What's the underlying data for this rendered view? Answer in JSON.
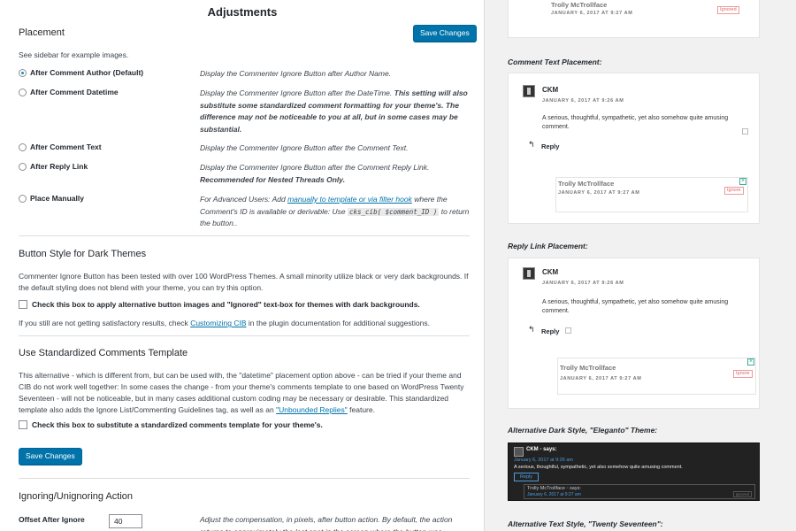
{
  "page": {
    "title": "Adjustments"
  },
  "placement": {
    "title": "Placement",
    "save_label": "Save Changes",
    "hint": "See sidebar for example images.",
    "options": [
      {
        "label": "After Comment Author (Default)",
        "desc": "Display the Commenter Ignore Button after Author Name.",
        "checked": true
      },
      {
        "label": "After Comment Datetime",
        "desc": "Display the Commenter Ignore Button after the DateTime.",
        "desc_bold": "This setting will also substitute some standardized comment formatting for your theme's. The difference may not be noticeable to you at all, but in some cases may be substantial.",
        "checked": false
      },
      {
        "label": "After Comment Text",
        "desc": "Display the Commenter Ignore Button after the Comment Text.",
        "checked": false
      },
      {
        "label": "After Reply Link",
        "desc": "Display the Commenter Ignore Button after the Comment Reply Link.",
        "desc_bold": "Recommended for Nested Threads Only.",
        "checked": false
      },
      {
        "label": "Place Manually",
        "desc_pre": "For Advanced Users: Add",
        "desc_link": "manually to template or via filter hook",
        "desc_mid": "where the Comment's ID is available or derivable: Use",
        "desc_code": "cks_cib( $comment_ID )",
        "desc_post": "to return the button..",
        "checked": false
      }
    ]
  },
  "dark": {
    "title": "Button Style for Dark Themes",
    "para": "Commenter Ignore Button has been tested with over 100 WordPress Themes. A small minority utilize black or very dark backgrounds. If the default styling does not blend with your theme, you can try this option.",
    "check_label": "Check this box to apply alternative button images and \"Ignored\" text-box for themes with dark backgrounds.",
    "note_pre": "If you still are not getting satisfactory results, check",
    "note_link": "Customizing CIB",
    "note_post": "in the plugin documentation for additional suggestions."
  },
  "template": {
    "title": "Use Standardized Comments Template",
    "para": "This alternative - which is different from, but can be used with, the \"datetime\" placement option above - can be tried if your theme and CIB do not work well together: In some cases the change - from your theme's comments template to one based on WordPress Twenty Seventeen - will not be noticeable, but in many cases additional custom coding may be necessary or desirable. This standardized template also adds the Ignore List/Commenting Guidelines tag, as well as an",
    "para_link": "\"Unbounded Replies\"",
    "para_end": "feature.",
    "check_label": "Check this box to substitute a standardized comments template for your theme's.",
    "save_label": "Save Changes"
  },
  "ignoring": {
    "title": "Ignoring/Unignoring Action",
    "offset_label": "Offset After Ignore",
    "offset_value": "40",
    "offset_desc": "Adjust the compensation, in pixels, after button action. By default, the action returns to approximately the last spot in the screen where the button was"
  },
  "sidebar": {
    "top_author": "Trolly McTrollface",
    "top_date": "JANUARY 6, 2017 AT 9:27 AM",
    "top_badge": "Ignored",
    "cap_text": "Comment Text Placement:",
    "cap_reply": "Reply Link Placement:",
    "cap_dark": "Alternative Dark Style, \"Eleganto\" Theme:",
    "cap_text_style": "Alternative Text Style, \"Twenty Seventeen\":",
    "author": "CKM",
    "date": "JANUARY 6, 2017 AT 9:26 AM",
    "comment": "A serious, thoughtful, sympathetic, yet also somehow quite amusing comment.",
    "reply": "Reply",
    "nested_author": "Trolly McTrollface",
    "nested_date": "JANUARY 6, 2017 AT 9:27 AM",
    "badge": "Ignore",
    "dark_says": "says:",
    "dark_author": "CKM",
    "dark_date": "January 6, 2017 at 9:26 am",
    "dark_comment": "A serious, thoughtful, sympathetic, yet also somehow quite amusing comment.",
    "dark_reply": "Reply",
    "dark_nested_author": "Trolly McTrollface",
    "dark_nested_date": "January 6, 2017 at 9:27 am",
    "dark_badge": "Ignored"
  },
  "colors": {
    "primary": "#0073aa",
    "background": "#f1f1f1",
    "panel": "#ffffff",
    "dark_card": "#222222"
  }
}
